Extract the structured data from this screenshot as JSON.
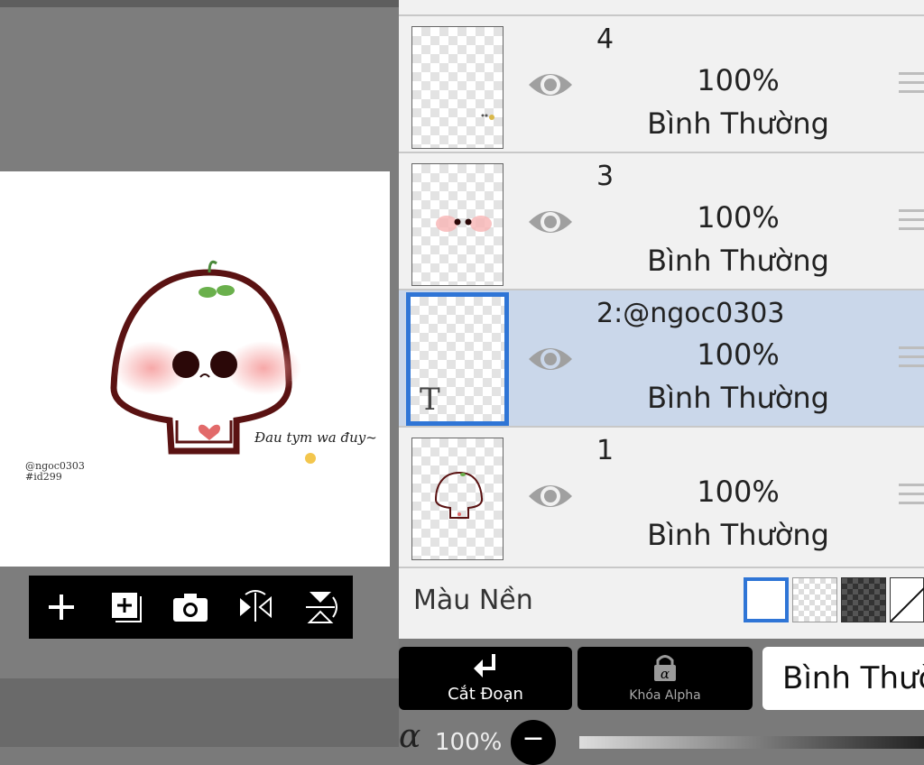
{
  "canvas": {
    "caption": "Đau tym wa đuy~",
    "watermark_line1": "@ngoc0303",
    "watermark_line2": "#id299"
  },
  "toolbar": {
    "icons": [
      "plus-icon",
      "add-layer-icon",
      "camera-icon",
      "flip-horizontal-icon",
      "flip-vertical-icon"
    ]
  },
  "layers": [
    {
      "name": "4",
      "opacity": "100%",
      "blend": "Bình Thường",
      "visible": true,
      "selected": false
    },
    {
      "name": "3",
      "opacity": "100%",
      "blend": "Bình Thường",
      "visible": true,
      "selected": false
    },
    {
      "name": "2:@ngoc0303",
      "opacity": "100%",
      "blend": "Bình Thường",
      "visible": true,
      "selected": true,
      "thumb_text": "T"
    },
    {
      "name": "1",
      "opacity": "100%",
      "blend": "Bình Thường",
      "visible": true,
      "selected": false
    }
  ],
  "background": {
    "label": "Màu Nền",
    "swatches": [
      "white",
      "transparent",
      "dark-checker",
      "diagonal"
    ]
  },
  "buttons": {
    "clipping_label": "Cắt Đoạn",
    "alpha_lock_label": "Khóa Alpha",
    "blend_mode_label": "Bình Thường"
  },
  "opacity": {
    "symbol": "α",
    "value": "100%"
  },
  "colors": {
    "selected_layer_bg": "#cad7ea",
    "selected_border": "#2f75d6",
    "panel_bg": "#f1f1f1",
    "toolbar_bg": "#000000"
  }
}
